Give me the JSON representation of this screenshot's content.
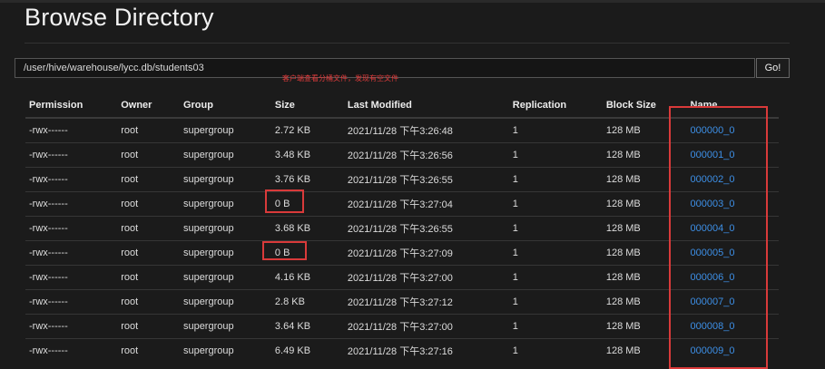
{
  "page": {
    "title": "Browse Directory"
  },
  "path": {
    "value": "/user/hive/warehouse/lycc.db/students03",
    "go_label": "Go!"
  },
  "annotation": {
    "text": "客户端查看分桶文件，发现有空文件"
  },
  "table": {
    "headers": [
      "Permission",
      "Owner",
      "Group",
      "Size",
      "Last Modified",
      "Replication",
      "Block Size",
      "Name"
    ],
    "rows": [
      [
        "-rwx------",
        "root",
        "supergroup",
        "2.72 KB",
        "2021/11/28 下午3:26:48",
        "1",
        "128 MB",
        "000000_0"
      ],
      [
        "-rwx------",
        "root",
        "supergroup",
        "3.48 KB",
        "2021/11/28 下午3:26:56",
        "1",
        "128 MB",
        "000001_0"
      ],
      [
        "-rwx------",
        "root",
        "supergroup",
        "3.76 KB",
        "2021/11/28 下午3:26:55",
        "1",
        "128 MB",
        "000002_0"
      ],
      [
        "-rwx------",
        "root",
        "supergroup",
        "0 B",
        "2021/11/28 下午3:27:04",
        "1",
        "128 MB",
        "000003_0"
      ],
      [
        "-rwx------",
        "root",
        "supergroup",
        "3.68 KB",
        "2021/11/28 下午3:26:55",
        "1",
        "128 MB",
        "000004_0"
      ],
      [
        "-rwx------",
        "root",
        "supergroup",
        "0 B",
        "2021/11/28 下午3:27:09",
        "1",
        "128 MB",
        "000005_0"
      ],
      [
        "-rwx------",
        "root",
        "supergroup",
        "4.16 KB",
        "2021/11/28 下午3:27:00",
        "1",
        "128 MB",
        "000006_0"
      ],
      [
        "-rwx------",
        "root",
        "supergroup",
        "2.8 KB",
        "2021/11/28 下午3:27:12",
        "1",
        "128 MB",
        "000007_0"
      ],
      [
        "-rwx------",
        "root",
        "supergroup",
        "3.64 KB",
        "2021/11/28 下午3:27:00",
        "1",
        "128 MB",
        "000008_0"
      ],
      [
        "-rwx------",
        "root",
        "supergroup",
        "6.49 KB",
        "2021/11/28 下午3:27:16",
        "1",
        "128 MB",
        "000009_0"
      ]
    ]
  },
  "colors": {
    "background": "#1b1b1b",
    "link": "#3d8fe6",
    "highlight": "#d93a3a"
  }
}
